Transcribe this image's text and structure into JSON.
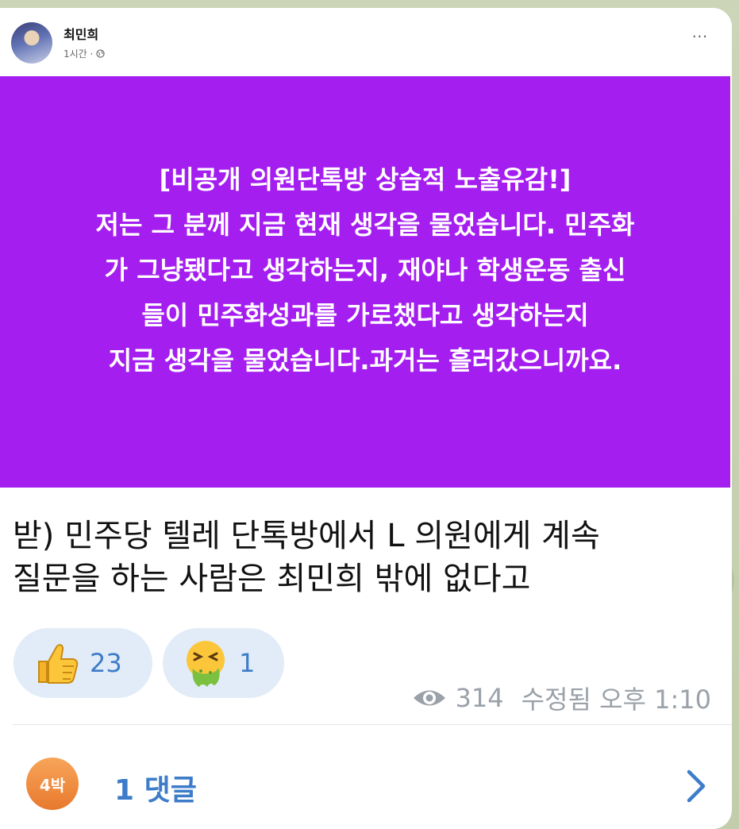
{
  "post": {
    "author": "최민희",
    "time": "1시간 ·",
    "more": "···",
    "purple_lines": [
      "[비공개 의원단톡방 상습적 노출유감!]",
      "저는 그 분께 지금 현재 생각을 물었습니다. 민주화",
      "가 그냥됐다고 생각하는지, 재야나 학생운동 출신",
      "들이 민주화성과를 가로챘다고 생각하는지",
      "지금 생각을 물었습니다.과거는 흘러갔으니까요."
    ],
    "background_color": "#a41ef0"
  },
  "message": {
    "caption_lines": [
      "받) 민주당 텔레 단톡방에서 L 의원에게 계속",
      "질문을 하는 사람은 최민희 밖에 없다고"
    ],
    "reactions": [
      {
        "icon": "thumbs-up-icon",
        "count": "23"
      },
      {
        "icon": "nauseated-face-icon",
        "count": "1"
      }
    ],
    "views": "314",
    "edited_time": "수정됨 오후 1:10",
    "badge": "4박",
    "comments": "1 댓글"
  },
  "colors": {
    "accent": "#3d7cc9",
    "reaction_bg": "#e1ecf8",
    "muted": "#9aa1a8"
  }
}
